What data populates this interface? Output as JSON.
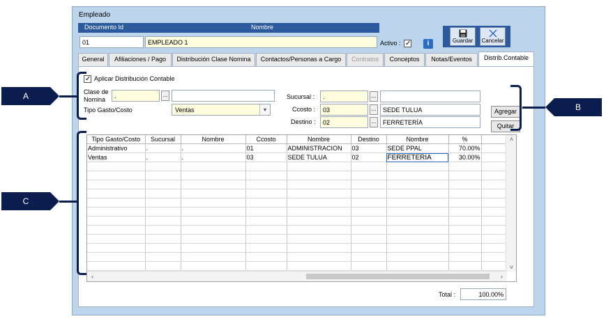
{
  "window": {
    "title": "Empleado"
  },
  "header": {
    "doc_id_label": "Documento Id",
    "name_label": "Nombre",
    "doc_id_value": "01",
    "name_value": "EMPLEADO 1",
    "activo_label": "Activo :",
    "activo_checked": true
  },
  "toolbar": {
    "save_label": "Guardar",
    "cancel_label": "Cancelar"
  },
  "tabs": [
    {
      "label": "General"
    },
    {
      "label": "Afiliaciones / Pago"
    },
    {
      "label": "Distribución Clase Nomina"
    },
    {
      "label": "Contactos/Personas a Cargo"
    },
    {
      "label": "Contratos",
      "disabled": true
    },
    {
      "label": "Conceptos"
    },
    {
      "label": "Notas/Eventos"
    },
    {
      "label": "Distrib.Contable",
      "active": true
    }
  ],
  "form": {
    "aplicar_label": "Aplicar Distribución Contable",
    "aplicar_checked": true,
    "clase_label_1": "Clase de",
    "clase_label_2": "Nomina",
    "clase_value": ".",
    "clase_name": "",
    "tipo_label": "Tipo Gasto/Costo",
    "tipo_value": "Ventas",
    "sucursal_label": "Sucursal :",
    "sucursal_value": ".",
    "sucursal_name": "",
    "ccosto_label": "Ccosto :",
    "ccosto_value": "03",
    "ccosto_name": "SEDE TULUA",
    "destino_label": "Destino :",
    "destino_value": "02",
    "destino_name": "FERRETERÍA",
    "agregar_label": "Agregar",
    "quitar_label": "Quitar",
    "ellipsis": "..."
  },
  "grid": {
    "columns": [
      "Tipo Gasto/Costo",
      "Sucursal",
      "Nombre",
      "Ccosto",
      "Nombre",
      "Destino",
      "Nombre",
      "%"
    ],
    "rows": [
      [
        "Administrativo",
        ".",
        ".",
        "01",
        "ADMINISTRACION",
        "03",
        "SEDE PPAL",
        "70.00%"
      ],
      [
        "Ventas",
        ".",
        ".",
        "03",
        "SEDE TULUA",
        "02",
        "FERRETERÍA",
        "30.00%"
      ]
    ],
    "empty_rows": 13
  },
  "total": {
    "label": "Total :",
    "value": "100.00%"
  },
  "callouts": {
    "a": "A",
    "b": "B",
    "c": "C"
  },
  "colors": {
    "accent": "#2d5a9c",
    "callout": "#0b1d4e",
    "field_bg": "#fffde0",
    "window_bg": "#bcd4ec"
  }
}
